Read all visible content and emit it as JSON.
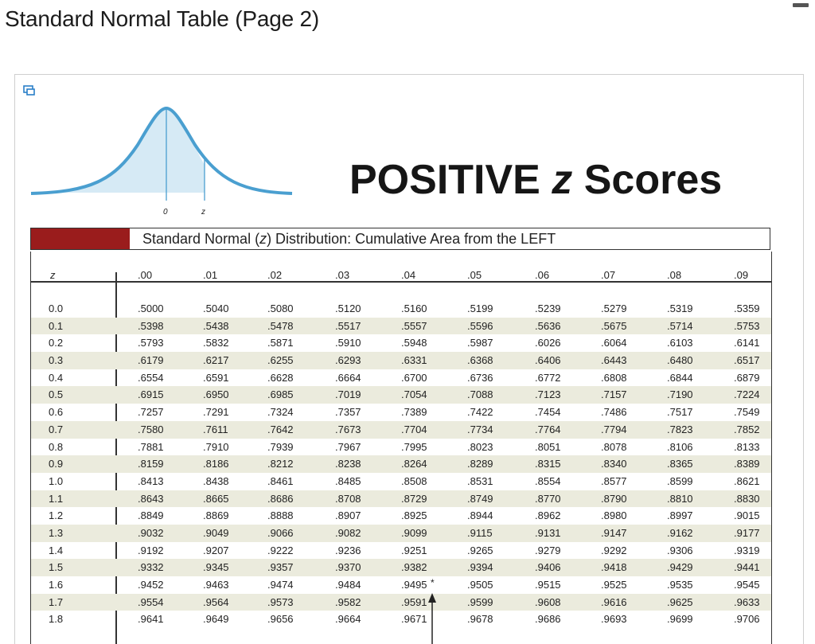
{
  "page_title": "Standard Normal Table (Page 2)",
  "figure": {
    "axis_zero": "0",
    "axis_z": "z"
  },
  "heading": {
    "prefix": "POSITIVE ",
    "z": "z",
    "suffix": " Scores"
  },
  "banner": {
    "before": "Standard Normal (",
    "z": "z",
    "after": ") Distribution: Cumulative Area from the LEFT"
  },
  "table": {
    "z_header": "z",
    "columns": [
      ".00",
      ".01",
      ".02",
      ".03",
      ".04",
      ".05",
      ".06",
      ".07",
      ".08",
      ".09"
    ],
    "rows": [
      {
        "z": "0.0",
        "values": [
          ".5000",
          ".5040",
          ".5080",
          ".5120",
          ".5160",
          ".5199",
          ".5239",
          ".5279",
          ".5319",
          ".5359"
        ]
      },
      {
        "z": "0.1",
        "values": [
          ".5398",
          ".5438",
          ".5478",
          ".5517",
          ".5557",
          ".5596",
          ".5636",
          ".5675",
          ".5714",
          ".5753"
        ]
      },
      {
        "z": "0.2",
        "values": [
          ".5793",
          ".5832",
          ".5871",
          ".5910",
          ".5948",
          ".5987",
          ".6026",
          ".6064",
          ".6103",
          ".6141"
        ]
      },
      {
        "z": "0.3",
        "values": [
          ".6179",
          ".6217",
          ".6255",
          ".6293",
          ".6331",
          ".6368",
          ".6406",
          ".6443",
          ".6480",
          ".6517"
        ]
      },
      {
        "z": "0.4",
        "values": [
          ".6554",
          ".6591",
          ".6628",
          ".6664",
          ".6700",
          ".6736",
          ".6772",
          ".6808",
          ".6844",
          ".6879"
        ]
      },
      {
        "z": "0.5",
        "values": [
          ".6915",
          ".6950",
          ".6985",
          ".7019",
          ".7054",
          ".7088",
          ".7123",
          ".7157",
          ".7190",
          ".7224"
        ]
      },
      {
        "z": "0.6",
        "values": [
          ".7257",
          ".7291",
          ".7324",
          ".7357",
          ".7389",
          ".7422",
          ".7454",
          ".7486",
          ".7517",
          ".7549"
        ]
      },
      {
        "z": "0.7",
        "values": [
          ".7580",
          ".7611",
          ".7642",
          ".7673",
          ".7704",
          ".7734",
          ".7764",
          ".7794",
          ".7823",
          ".7852"
        ]
      },
      {
        "z": "0.8",
        "values": [
          ".7881",
          ".7910",
          ".7939",
          ".7967",
          ".7995",
          ".8023",
          ".8051",
          ".8078",
          ".8106",
          ".8133"
        ]
      },
      {
        "z": "0.9",
        "values": [
          ".8159",
          ".8186",
          ".8212",
          ".8238",
          ".8264",
          ".8289",
          ".8315",
          ".8340",
          ".8365",
          ".8389"
        ]
      },
      {
        "z": "1.0",
        "values": [
          ".8413",
          ".8438",
          ".8461",
          ".8485",
          ".8508",
          ".8531",
          ".8554",
          ".8577",
          ".8599",
          ".8621"
        ]
      },
      {
        "z": "1.1",
        "values": [
          ".8643",
          ".8665",
          ".8686",
          ".8708",
          ".8729",
          ".8749",
          ".8770",
          ".8790",
          ".8810",
          ".8830"
        ]
      },
      {
        "z": "1.2",
        "values": [
          ".8849",
          ".8869",
          ".8888",
          ".8907",
          ".8925",
          ".8944",
          ".8962",
          ".8980",
          ".8997",
          ".9015"
        ]
      },
      {
        "z": "1.3",
        "values": [
          ".9032",
          ".9049",
          ".9066",
          ".9082",
          ".9099",
          ".9115",
          ".9131",
          ".9147",
          ".9162",
          ".9177"
        ]
      },
      {
        "z": "1.4",
        "values": [
          ".9192",
          ".9207",
          ".9222",
          ".9236",
          ".9251",
          ".9265",
          ".9279",
          ".9292",
          ".9306",
          ".9319"
        ]
      },
      {
        "z": "1.5",
        "values": [
          ".9332",
          ".9345",
          ".9357",
          ".9370",
          ".9382",
          ".9394",
          ".9406",
          ".9418",
          ".9429",
          ".9441"
        ]
      },
      {
        "z": "1.6",
        "values": [
          ".9452",
          ".9463",
          ".9474",
          ".9484",
          ".9495",
          ".9505",
          ".9515",
          ".9525",
          ".9535",
          ".9545"
        ]
      },
      {
        "z": "1.7",
        "values": [
          ".9554",
          ".9564",
          ".9573",
          ".9582",
          ".9591",
          ".9599",
          ".9608",
          ".9616",
          ".9625",
          ".9633"
        ]
      },
      {
        "z": "1.8",
        "values": [
          ".9641",
          ".9649",
          ".9656",
          ".9664",
          ".9671",
          ".9678",
          ".9686",
          ".9693",
          ".9699",
          ".9706"
        ]
      }
    ],
    "marker": "*"
  },
  "colors": {
    "curve": "#4a9fd0",
    "curve_fill": "#d6eaf5",
    "banner_red": "#9a1c1c",
    "row_shade": "#ebebdd"
  },
  "icons": [
    "expand-icon",
    "minimize-icon"
  ]
}
